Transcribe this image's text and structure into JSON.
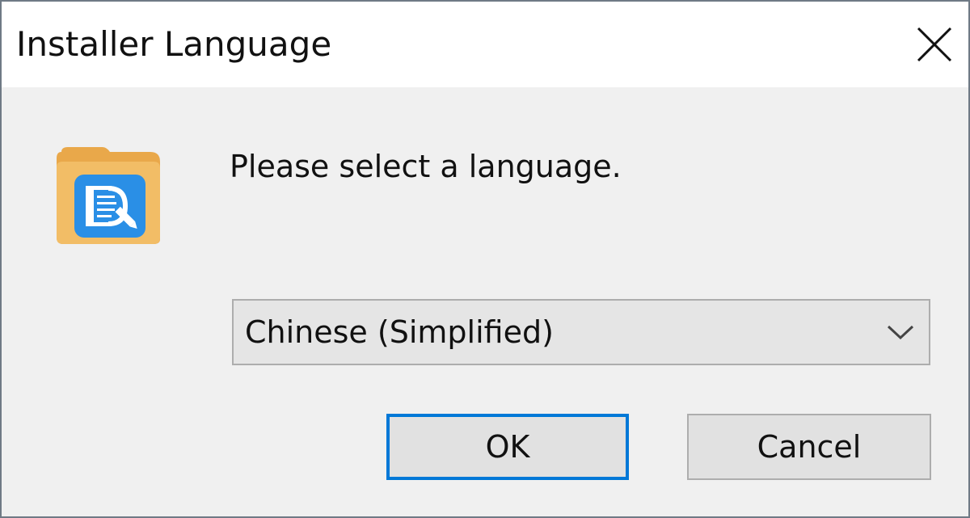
{
  "window": {
    "title": "Installer Language",
    "close_icon": "close-icon"
  },
  "content": {
    "app_icon": "installer-app-icon",
    "prompt": "Please select a language.",
    "language_select": {
      "selected": "Chinese (Simplified)",
      "arrow_icon": "chevron-down-icon"
    }
  },
  "buttons": {
    "ok_label": "OK",
    "cancel_label": "Cancel"
  },
  "colors": {
    "accent": "#0078d7",
    "dialog_bg": "#f0f0f0",
    "titlebar_bg": "#ffffff",
    "icon_folder": "#f0b861",
    "icon_badge": "#2a8fe6"
  }
}
